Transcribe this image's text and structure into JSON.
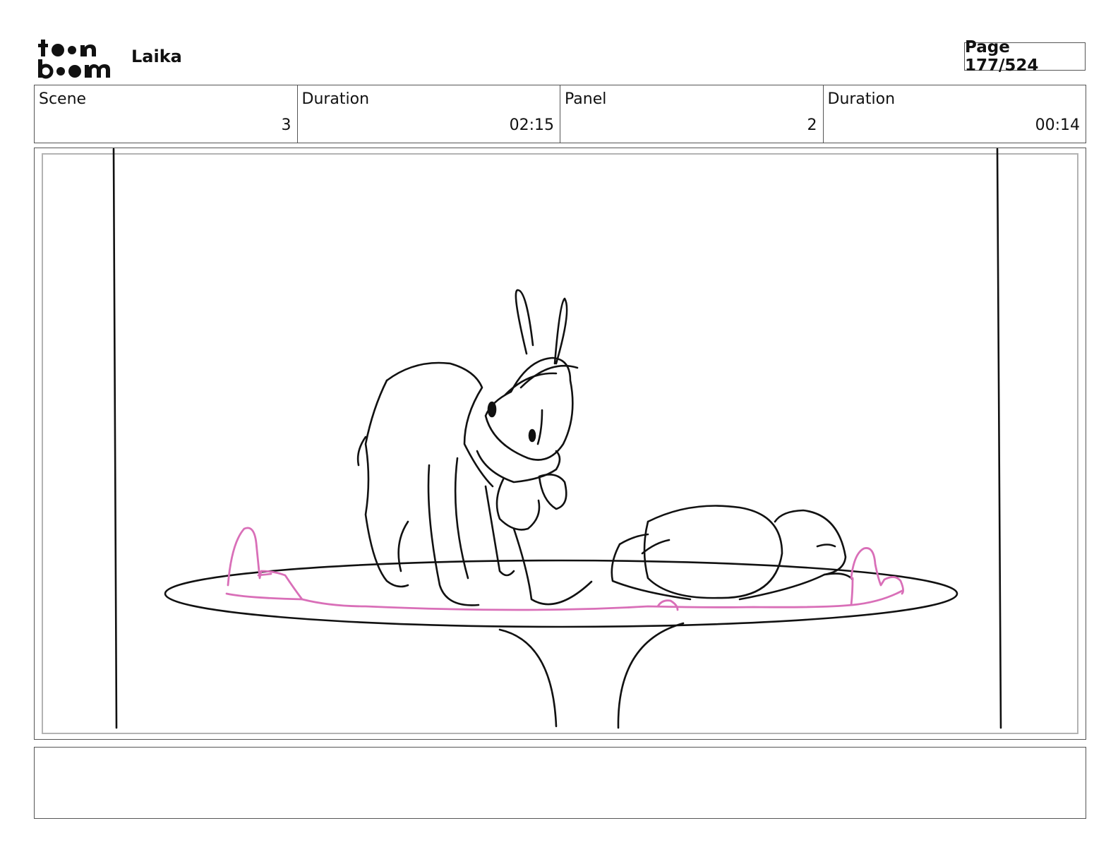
{
  "header": {
    "logo_text": "toonboom",
    "project_title": "Laika",
    "page_label": "Page 177/524"
  },
  "info": [
    {
      "label": "Scene",
      "value": "3"
    },
    {
      "label": "Duration",
      "value": "02:15"
    },
    {
      "label": "Panel",
      "value": "2"
    },
    {
      "label": "Duration",
      "value": "00:14"
    }
  ],
  "colors": {
    "sketch_line": "#111111",
    "pink_line": "#d96fb8",
    "frame_gray": "#b3b3b3"
  },
  "notes": {
    "text": ""
  }
}
